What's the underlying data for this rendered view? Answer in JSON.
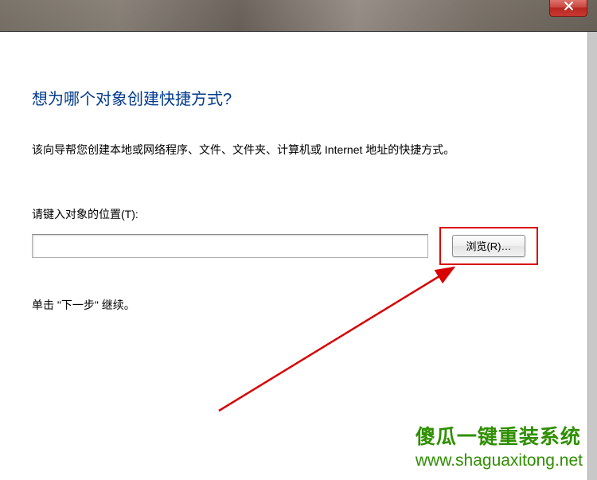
{
  "titlebar": {
    "close_aria": "关闭"
  },
  "dialog": {
    "heading": "想为哪个对象创建快捷方式?",
    "description": "该向导帮您创建本地或网络程序、文件、文件夹、计算机或 Internet 地址的快捷方式。",
    "location_label": "请键入对象的位置(T):",
    "location_value": "",
    "browse_label": "浏览(R)…",
    "hint": "单击 \"下一步\" 继续。"
  },
  "watermark": {
    "line1": "傻瓜一键重装系统",
    "line2": "www.shaguaxitong.net"
  },
  "annotation": {
    "highlight_color": "#d90000",
    "arrow_color": "#d90000"
  }
}
